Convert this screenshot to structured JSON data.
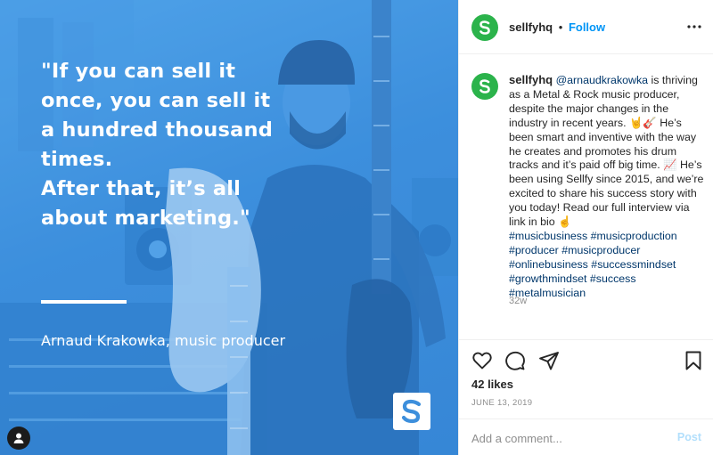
{
  "media": {
    "quote_lines": [
      "\"If you can sell it",
      "once, you can sell it",
      "a hundred thousand",
      "times.",
      "After that, it’s all",
      "about marketing.\""
    ],
    "attribution": "Arnaud Krakowka, music producer",
    "badge_icon": "sellfy-logo-icon",
    "tint_color": "#3d8fdc"
  },
  "header": {
    "username": "sellfyhq",
    "separator": "•",
    "follow_label": "Follow",
    "avatar_letter": "S",
    "avatar_color": "#2bb34b"
  },
  "caption": {
    "username": "sellfyhq",
    "mention": "@arnaudkrakowka",
    "text": " is thriving as a Metal & Rock music producer, despite the major changes in the industry in recent years. 🤘🎸 He’s been smart and inventive with the way he creates and promotes his drum tracks and it’s paid off big time. 📈 He’s been using Sellfy since 2015, and we’re excited to share his success story with you today! Read our full interview via link in bio ☝️",
    "hashtags": [
      "#musicbusiness #musicproduction",
      "#producer #musicproducer",
      "#onlinebusiness #successmindset",
      "#growthmindset #success",
      "#metalmusician"
    ],
    "time_ago": "32w"
  },
  "actions": {
    "icons": [
      "heart-icon",
      "comment-icon",
      "share-icon",
      "bookmark-icon"
    ]
  },
  "likes": "42 likes",
  "date": "JUNE 13, 2019",
  "comment": {
    "placeholder": "Add a comment...",
    "value": "",
    "post_label": "Post"
  }
}
